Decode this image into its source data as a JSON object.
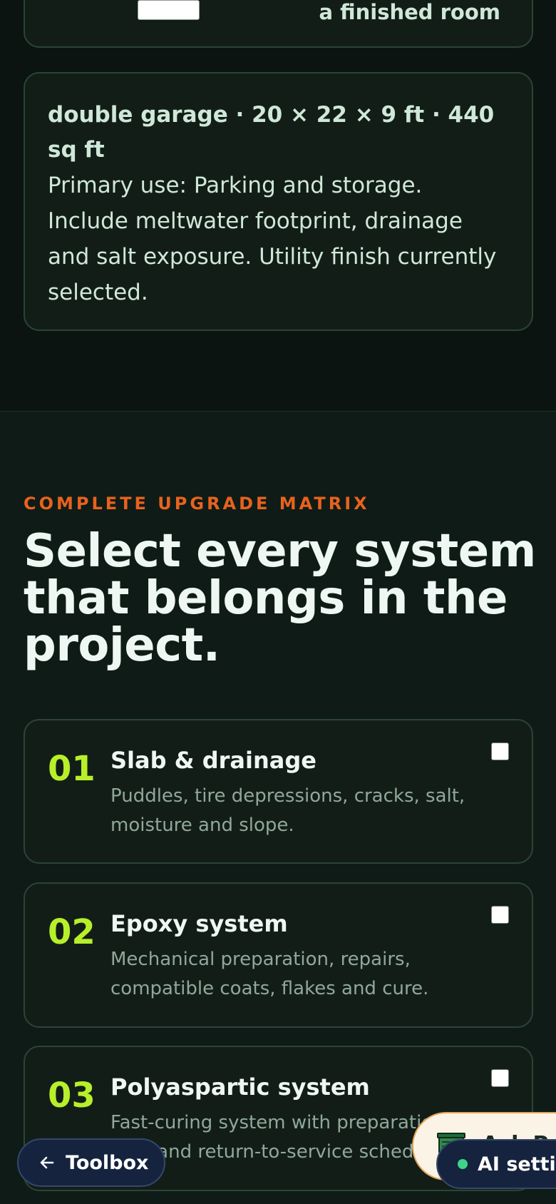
{
  "room_card": {
    "finished_room_label": "a finished room"
  },
  "garage_card": {
    "title": "double garage · 20 × 22 × 9 ft · 440 sq ft",
    "description": "Primary use: Parking and storage. Include meltwater footprint, drainage and salt exposure. Utility finish currently selected."
  },
  "matrix": {
    "eyebrow": "COMPLETE UPGRADE MATRIX",
    "headline": "Select every system that belongs in the project.",
    "systems": [
      {
        "number": "01",
        "name": "Slab & drainage",
        "description": "Puddles, tire depressions, cracks, salt, moisture and slope.",
        "checked": false
      },
      {
        "number": "02",
        "name": "Epoxy system",
        "description": "Mechanical preparation, repairs, compatible coats, flakes and cure.",
        "checked": false
      },
      {
        "number": "03",
        "name": "Polyaspartic system",
        "description": "Fast-curing system with preparation, cure and return-to-service schedule.",
        "checked": false
      }
    ]
  },
  "floating": {
    "toolbox_label": "Toolbox",
    "ask_label": "Ask Pro",
    "ai_settings_label": "AI settings",
    "ai_status_color": "#3fd38a"
  },
  "colors": {
    "accent_orange": "#e8621e",
    "accent_lime": "#b7ef2a",
    "background": "#0b1410"
  }
}
